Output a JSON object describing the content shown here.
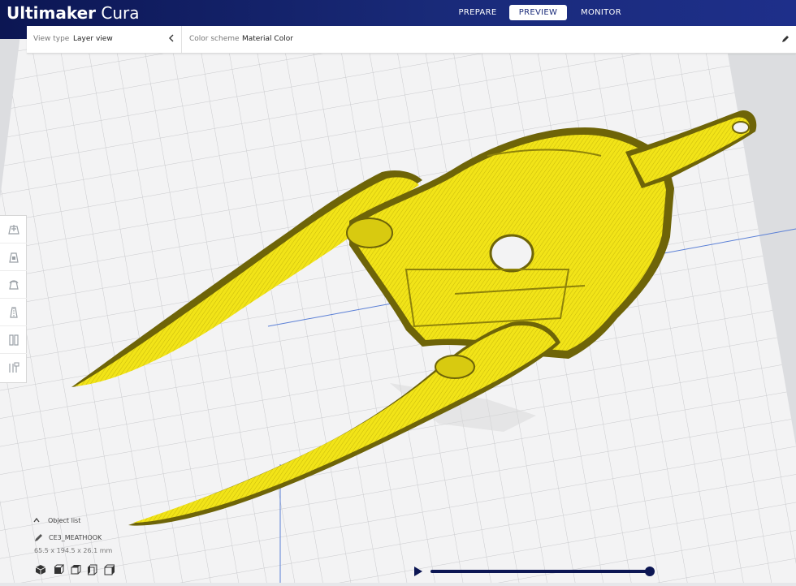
{
  "app": {
    "brand_bold": "Ultimaker",
    "brand_light": "Cura"
  },
  "stages": [
    {
      "label": "PREPARE",
      "active": false
    },
    {
      "label": "PREVIEW",
      "active": true
    },
    {
      "label": "MONITOR",
      "active": false
    }
  ],
  "view_bar": {
    "view_type_label": "View type",
    "view_type_value": "Layer view",
    "color_scheme_label": "Color scheme",
    "color_scheme_value": "Material Color"
  },
  "toolbar": {
    "icons": [
      "move-icon",
      "scale-icon",
      "rotate-icon",
      "mirror-icon",
      "per-model-settings-icon",
      "support-blocker-icon"
    ]
  },
  "object_list": {
    "header": "Object list",
    "object_name": "CE3_MEATHOOK",
    "dimensions": "65.5 x 194.5 x 26.1 mm"
  },
  "view_buttons": [
    "3d-view-icon",
    "front-view-icon",
    "top-view-icon",
    "left-view-icon",
    "right-view-icon"
  ],
  "colors": {
    "topbar": "#192a79",
    "material": "#f2e418",
    "material_shadow": "#6e6408",
    "build_plate": "#f3f3f4"
  }
}
